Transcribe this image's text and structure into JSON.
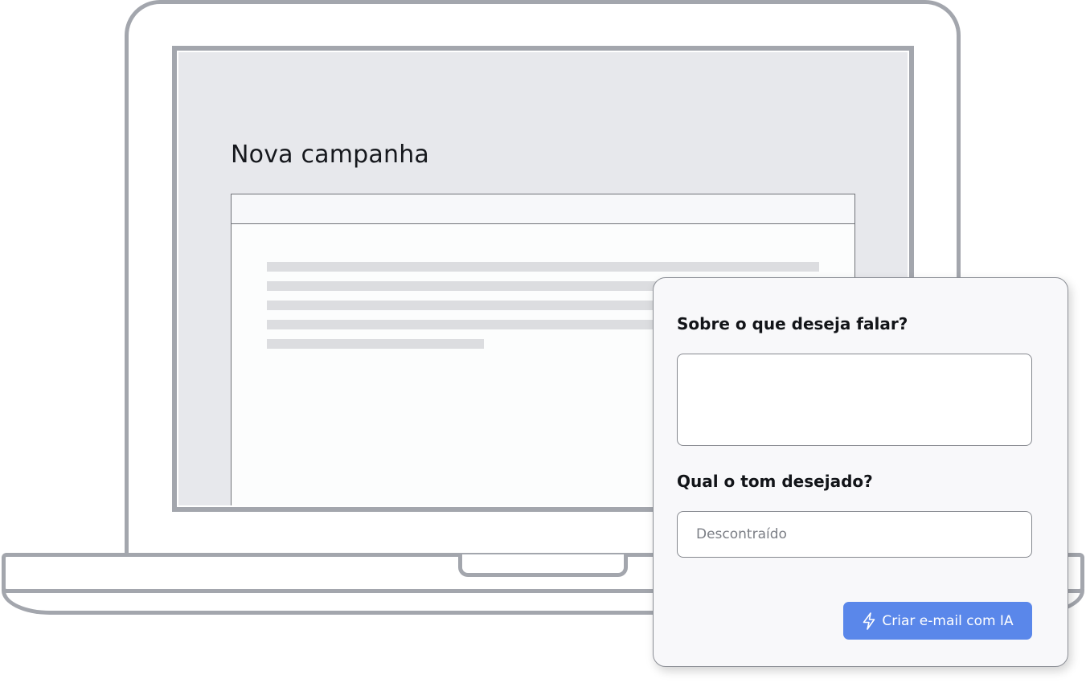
{
  "campaign_screen": {
    "title": "Nova campanha"
  },
  "ai_form": {
    "topic_label": "Sobre o que deseja falar?",
    "topic_value": "",
    "tone_label": "Qual o tom desejado?",
    "tone_placeholder": "Descontraído",
    "tone_value": "",
    "submit_label": "Criar e-mail com IA",
    "submit_icon": "lightning-bolt-icon"
  },
  "colors": {
    "accent": "#5a87ea",
    "laptop_outline": "#a3a6ad",
    "screen_bg": "#e7e8ec",
    "card_bg": "#f8f8fa"
  }
}
